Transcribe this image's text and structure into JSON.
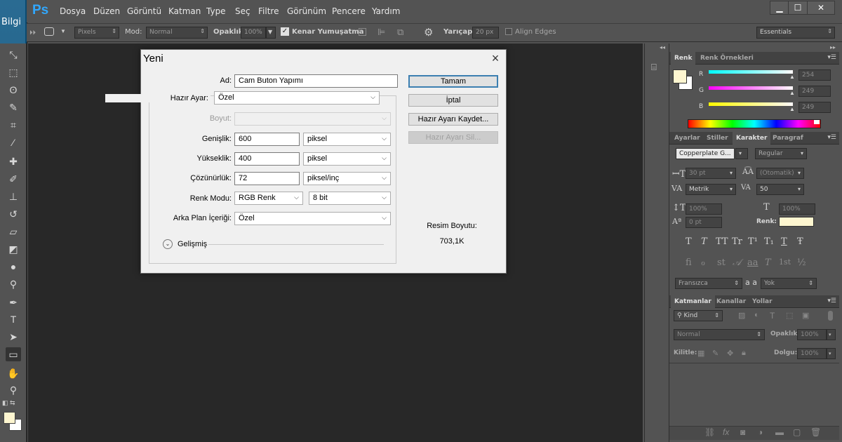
{
  "desktop": {
    "label": "Bilgi"
  },
  "menubar": {
    "logo": "Ps",
    "items": [
      "Dosya",
      "Düzen",
      "Görüntü",
      "Katman",
      "Type",
      "Seç",
      "Filtre",
      "Görünüm",
      "Pencere",
      "Yardım"
    ],
    "min": "▁",
    "max": "☐",
    "close": "✕"
  },
  "options": {
    "pixels": "Pixels",
    "mode_label": "Mod:",
    "mode": "Normal",
    "opacity_label": "Opaklık:",
    "opacity": "100%",
    "antialias_label": "Kenar Yumuşatma",
    "radius_label": "Yarıçap:",
    "radius": "20 px",
    "align_label": "Align Edges",
    "workspace": "Essentials"
  },
  "dialog": {
    "title": "Yeni",
    "name_label": "Ad:",
    "name": "Cam Buton Yapımı",
    "preset_label": "Hazır Ayar:",
    "preset": "Özel",
    "size_label": "Boyut:",
    "width_label": "Genişlik:",
    "width": "600",
    "width_unit": "piksel",
    "height_label": "Yükseklik:",
    "height": "400",
    "height_unit": "piksel",
    "res_label": "Çözünürlük:",
    "res": "72",
    "res_unit": "piksel/inç",
    "color_label": "Renk Modu:",
    "color_mode": "RGB Renk",
    "bit": "8 bit",
    "bg_label": "Arka Plan İçeriği:",
    "bg": "Özel",
    "advanced": "Gelişmiş",
    "ok": "Tamam",
    "cancel": "İptal",
    "save_preset": "Hazır Ayarı Kaydet...",
    "delete_preset": "Hazır Ayarı Sil...",
    "image_size_label": "Resim Boyutu:",
    "image_size": "703,1K"
  },
  "color_panel": {
    "tabs": [
      "Renk",
      "Renk Örnekleri"
    ],
    "r_label": "R",
    "r": "254",
    "g_label": "G",
    "g": "249",
    "b_label": "B",
    "b": "249",
    "fg_color": "#fef6d0",
    "bg_color": "#ffffff"
  },
  "char_panel": {
    "tabs": [
      "Ayarlar",
      "Stiller",
      "Karakter",
      "Paragraf"
    ],
    "font": "Copperplate G...",
    "style": "Regular",
    "size": "30 pt",
    "leading": "(Otomatik)",
    "kerning": "Metrik",
    "tracking": "50",
    "vscale": "100%",
    "hscale": "100%",
    "baseline": "0 pt",
    "color_label": "Renk:",
    "language": "Fransızca",
    "aa_icon": "a a",
    "aa": "Yok",
    "typo1": [
      "T",
      "T",
      "TT",
      "Tr",
      "T¹",
      "T₁",
      "T",
      "Ŧ"
    ],
    "typo2": [
      "fi",
      "ℴ",
      "st",
      "𝒜",
      "aa",
      "T",
      "1st",
      "½"
    ]
  },
  "layers_panel": {
    "tabs": [
      "Katmanlar",
      "Kanallar",
      "Yollar"
    ],
    "kind": "Kind",
    "blend": "Normal",
    "opacity_label": "Opaklık:",
    "opacity": "100%",
    "lock_label": "Kilitle:",
    "fill_label": "Dolgu:",
    "fill": "100%"
  }
}
